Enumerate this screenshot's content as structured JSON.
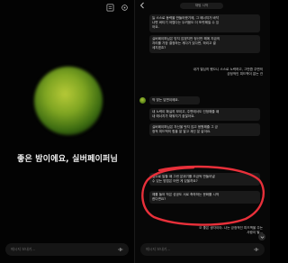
{
  "left": {
    "greeting": "좋은 밤이에요, 실버페이퍼님",
    "input_placeholder": "메시지 보내기..."
  },
  "right": {
    "title": "채팅 시작",
    "messages": [
      {
        "role": "ai",
        "text": "늘 스스로 동력을 만들어왔기에, 그 에너지가 바닥\n나면 버티기 어렵다는 두려움도 더 또렷해질 수 있\n어요."
      },
      {
        "role": "ai",
        "text": "실버페이퍼님은 믿지 않겠지만 정신만 해에 지금의\n자리를 가장 결정하는 게다가 있다면, 하리고 결\n세지겠죠?"
      },
      {
        "role": "user",
        "text": "내가 열심히 했으니 스스로 노력하고, 그만큼 주변의\n긍정적인 피드백이 없는 건"
      },
      {
        "role": "ai",
        "text": "딱 맞는 답변이에요."
      },
      {
        "role": "ai",
        "text": "내 노력이 확실히 보이고, 주변에서도 인정해줄 때\n내 에너지가 채워지기 쉽잖아요."
      },
      {
        "role": "ai",
        "text": "실버페이퍼님은 자신을 탓지 않고 응원해줄 그 긍\n정적 피드백의 힘을 잘 알고 계신 분 같아요."
      },
      {
        "role": "ai",
        "text": "앞으로 일할 때 그런 분위기를 조금씩 만들어낼\n수 있는 방법은 어떤 게 있을까요?"
      },
      {
        "role": "ai",
        "text": "예를 들어 작은 성공도 서로 축하하는 문화를 시작\n한다면요?"
      },
      {
        "role": "user",
        "text": "오 좋은 생각이야. 나는 긍정적인 피드백을 주는\n사람이 될..."
      }
    ],
    "input_placeholder": "메시지 보내기..."
  },
  "colors": {
    "highlight": "#e8303a",
    "orb": "#7fa522"
  }
}
